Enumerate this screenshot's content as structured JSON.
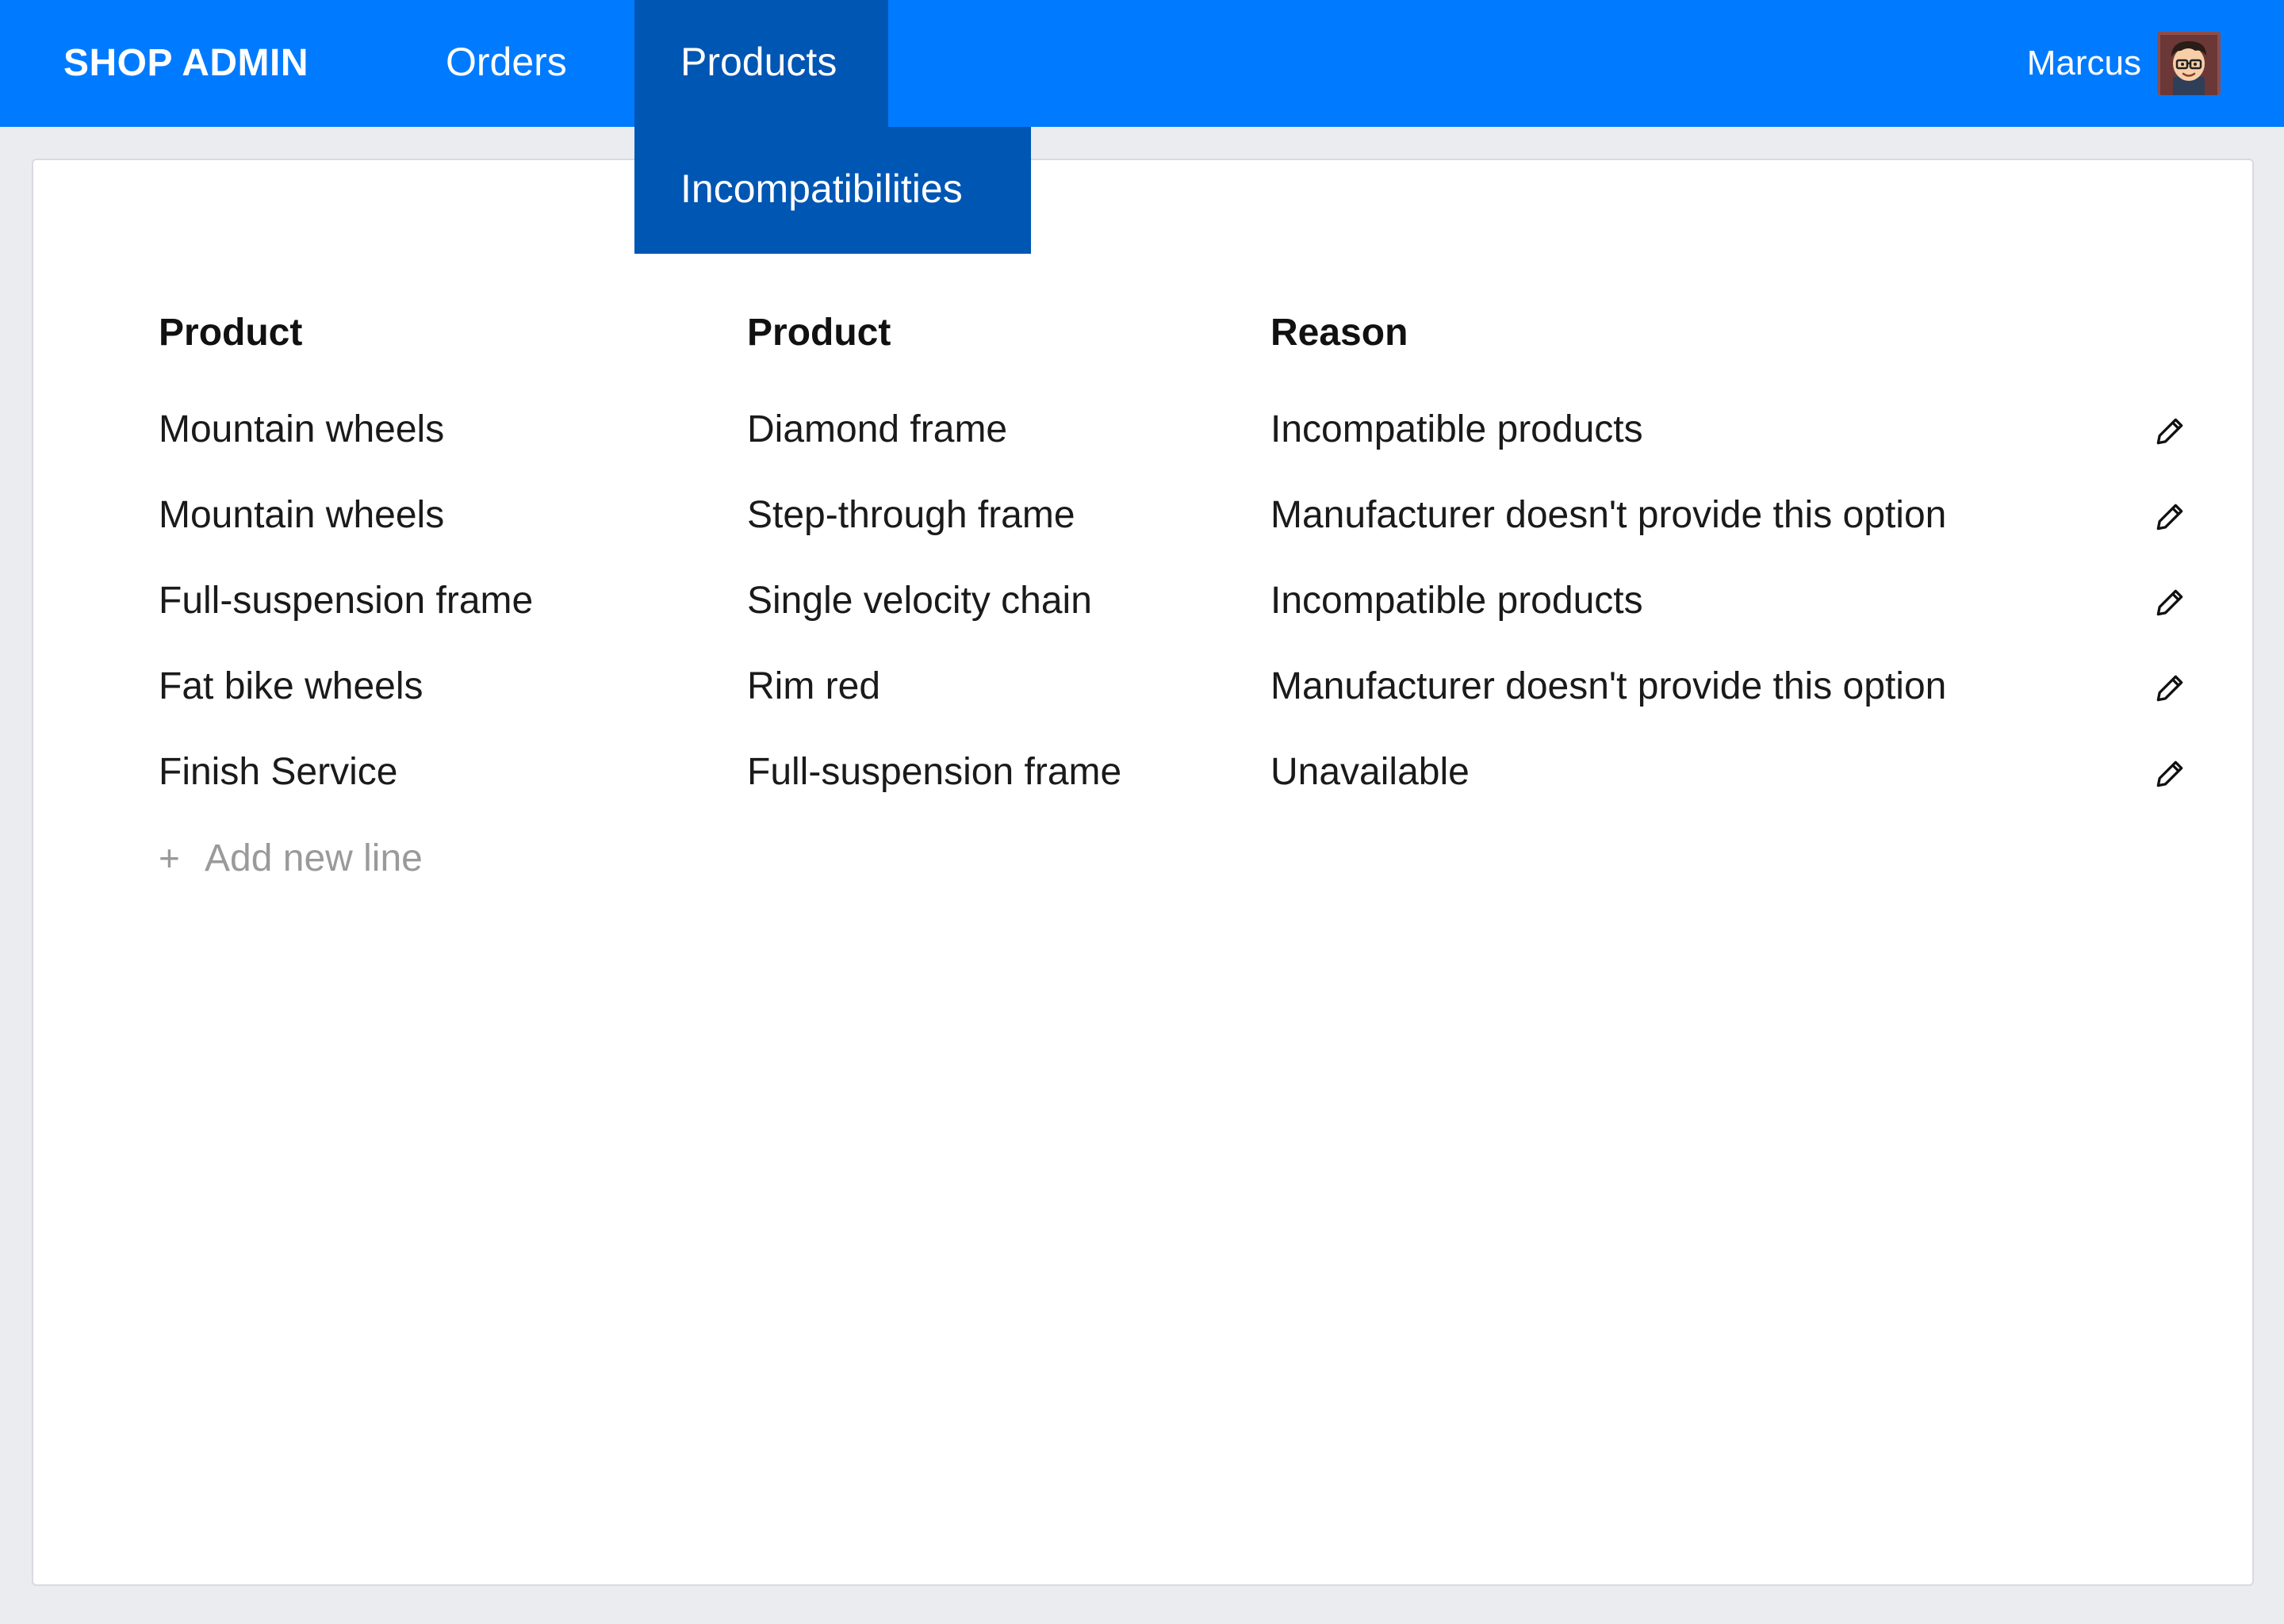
{
  "header": {
    "brand": "SHOP ADMIN",
    "nav": [
      {
        "label": "Orders"
      },
      {
        "label": "Products"
      }
    ],
    "dropdown": [
      {
        "label": "Incompatibilities"
      }
    ],
    "user_name": "Marcus"
  },
  "table": {
    "headers": [
      "Product",
      "Product",
      "Reason"
    ],
    "rows": [
      [
        "Mountain wheels",
        "Diamond frame",
        "Incompatible products"
      ],
      [
        "Mountain wheels",
        "Step-through frame",
        "Manufacturer doesn't provide this option"
      ],
      [
        "Full-suspension frame",
        "Single velocity chain",
        "Incompatible products"
      ],
      [
        "Fat bike wheels",
        "Rim red",
        "Manufacturer doesn't provide this option"
      ],
      [
        "Finish Service",
        "Full-suspension frame",
        "Unavailable"
      ]
    ],
    "row_action_icon": "pencil-icon",
    "add_line_icon": "+",
    "add_line_label": "Add new line"
  },
  "colors": {
    "topbar": "#007bff",
    "active_nav": "#0056b3",
    "page_bg": "#eaecef",
    "card_bg": "#ffffff",
    "muted_text": "#9a9a9a"
  }
}
